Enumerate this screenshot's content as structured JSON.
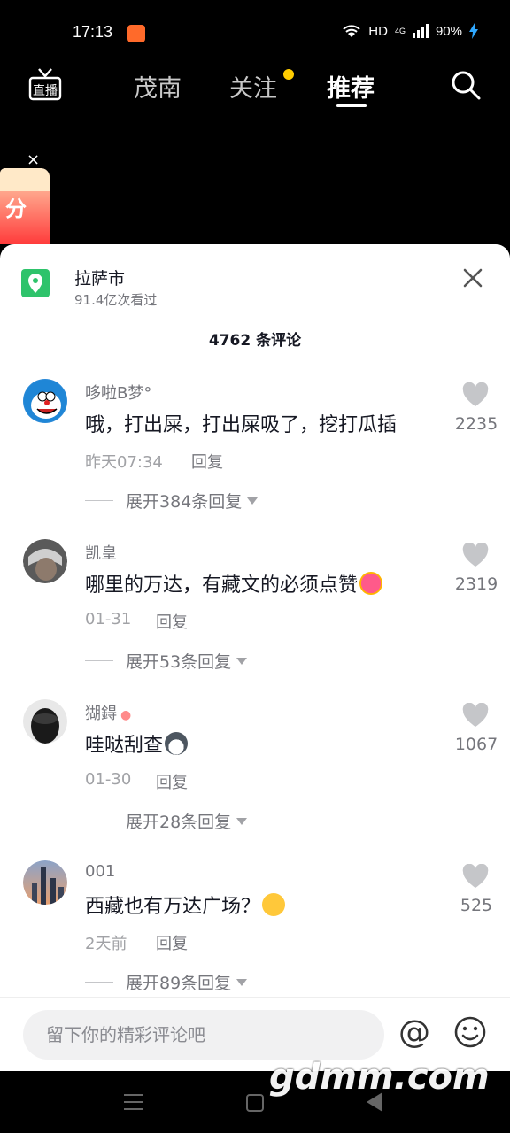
{
  "status_bar": {
    "time": "17:13",
    "network": "HD",
    "signal": "4G",
    "battery": "90%"
  },
  "top_nav": {
    "tabs": [
      {
        "label": "茂南"
      },
      {
        "label": "关注"
      },
      {
        "label": "推荐"
      }
    ],
    "live_label": "直播"
  },
  "ad": {
    "close": "×",
    "text": "分"
  },
  "location": {
    "title": "拉萨市",
    "views": "91.4亿次看过",
    "close": "✕"
  },
  "comments_count": "4762 条评论",
  "comments": [
    {
      "author": "哆啦B梦°",
      "text": "哦，打出屎，打出屎吸了，挖打瓜插",
      "time": "昨天07:34",
      "reply": "回复",
      "likes": "2235",
      "expand": "展开384条回复"
    },
    {
      "author": "凯皇",
      "text": "哪里的万达，有藏文的必须点赞",
      "time": "01-31",
      "reply": "回复",
      "likes": "2319",
      "expand": "展开53条回复"
    },
    {
      "author": "猢鍀",
      "text": "哇哒刮查",
      "time": "01-30",
      "reply": "回复",
      "likes": "1067",
      "expand": "展开28条回复"
    },
    {
      "author": "001",
      "text": "西藏也有万达广场？",
      "time": "2天前",
      "reply": "回复",
      "likes": "525",
      "expand": "展开89条回复"
    }
  ],
  "input": {
    "placeholder": "留下你的精彩评论吧",
    "at": "@"
  },
  "watermark": "gdmm.com",
  "colors": {
    "accent_dot": "#ffcc00",
    "location_green": "#2ec36b"
  }
}
